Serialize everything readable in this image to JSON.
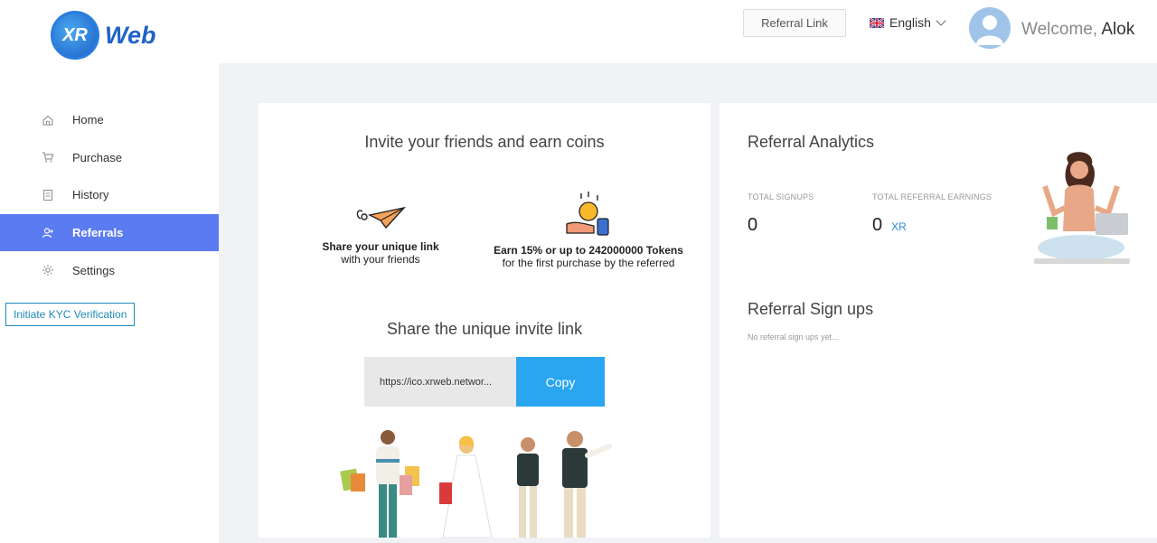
{
  "brand": {
    "logo_mark": "XR",
    "logo_word": "Web"
  },
  "sidebar": {
    "items": [
      {
        "label": "Home",
        "icon": "home-icon",
        "active": false
      },
      {
        "label": "Purchase",
        "icon": "cart-icon",
        "active": false
      },
      {
        "label": "History",
        "icon": "history-icon",
        "active": false
      },
      {
        "label": "Referrals",
        "icon": "referrals-icon",
        "active": true
      },
      {
        "label": "Settings",
        "icon": "gear-icon",
        "active": false
      }
    ],
    "kyc_button": "Initiate KYC Verification"
  },
  "header": {
    "referral_link_button": "Referral Link",
    "language": "English",
    "welcome_prefix": "Welcome,",
    "user_name": "Alok"
  },
  "invite": {
    "title": "Invite your friends and earn coins",
    "feature1_bold": "Share your unique link",
    "feature1_sub": "with your friends",
    "feature2_bold": "Earn 15% or up to 242000000 Tokens",
    "feature2_sub": "for the first purchase by the referred",
    "share_title": "Share the unique invite link",
    "link_value": "https://ico.xrweb.networ...",
    "copy_label": "Copy"
  },
  "analytics": {
    "title": "Referral Analytics",
    "signups_label": "TOTAL SIGNUPS",
    "signups_value": "0",
    "earnings_label": "TOTAL REFERRAL EARNINGS",
    "earnings_value": "0",
    "earnings_unit": "XR",
    "signups_title": "Referral Sign ups",
    "signups_empty": "No referral sign ups yet..."
  },
  "colors": {
    "accent": "#5b7bf0",
    "copy_button": "#2aa6f0",
    "kyc_border": "#1f8bbb"
  }
}
